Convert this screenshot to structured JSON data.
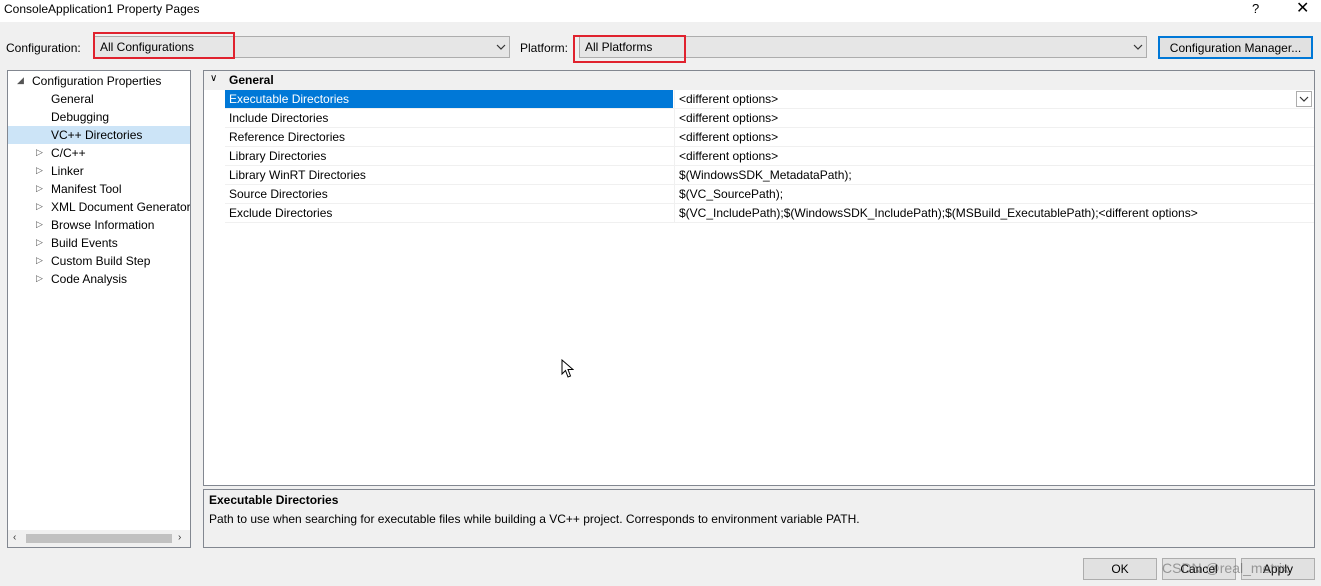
{
  "window": {
    "title": "ConsoleApplication1 Property Pages",
    "help_glyph": "?",
    "close_glyph": "✕"
  },
  "toolbar": {
    "configuration_label": "Configuration:",
    "configuration_value": "All Configurations",
    "platform_label": "Platform:",
    "platform_value": "All Platforms",
    "config_manager_label": "Configuration Manager..."
  },
  "tree": {
    "items": [
      {
        "label": "Configuration Properties",
        "twisty": "◢",
        "selected": false
      },
      {
        "label": "General",
        "twisty": "",
        "selected": false
      },
      {
        "label": "Debugging",
        "twisty": "",
        "selected": false
      },
      {
        "label": "VC++ Directories",
        "twisty": "",
        "selected": true
      },
      {
        "label": "C/C++",
        "twisty": "▷",
        "selected": false
      },
      {
        "label": "Linker",
        "twisty": "▷",
        "selected": false
      },
      {
        "label": "Manifest Tool",
        "twisty": "▷",
        "selected": false
      },
      {
        "label": "XML Document Generator",
        "twisty": "▷",
        "selected": false
      },
      {
        "label": "Browse Information",
        "twisty": "▷",
        "selected": false
      },
      {
        "label": "Build Events",
        "twisty": "▷",
        "selected": false
      },
      {
        "label": "Custom Build Step",
        "twisty": "▷",
        "selected": false
      },
      {
        "label": "Code Analysis",
        "twisty": "▷",
        "selected": false
      }
    ],
    "scroll_left": "‹",
    "scroll_right": "›"
  },
  "grid": {
    "category": "General",
    "chevron": "∨",
    "rows": [
      {
        "name": "Executable Directories",
        "value": "<different options>",
        "selected": true
      },
      {
        "name": "Include Directories",
        "value": "<different options>",
        "selected": false
      },
      {
        "name": "Reference Directories",
        "value": "<different options>",
        "selected": false
      },
      {
        "name": "Library Directories",
        "value": "<different options>",
        "selected": false
      },
      {
        "name": "Library WinRT Directories",
        "value": "$(WindowsSDK_MetadataPath);",
        "selected": false
      },
      {
        "name": "Source Directories",
        "value": "$(VC_SourcePath);",
        "selected": false
      },
      {
        "name": "Exclude Directories",
        "value": "$(VC_IncludePath);$(WindowsSDK_IncludePath);$(MSBuild_ExecutablePath);<different options>",
        "selected": false
      }
    ]
  },
  "description": {
    "title": "Executable Directories",
    "text": "Path to use when searching for executable files while building a VC++ project.  Corresponds to environment variable PATH."
  },
  "buttons": {
    "ok": "OK",
    "cancel": "Cancel",
    "apply": "Apply"
  },
  "watermark": "CSDN @real_metrix",
  "colors": {
    "accent": "#0078d7",
    "highlight_box": "#e0222e",
    "tree_selection": "#cce4f7"
  }
}
